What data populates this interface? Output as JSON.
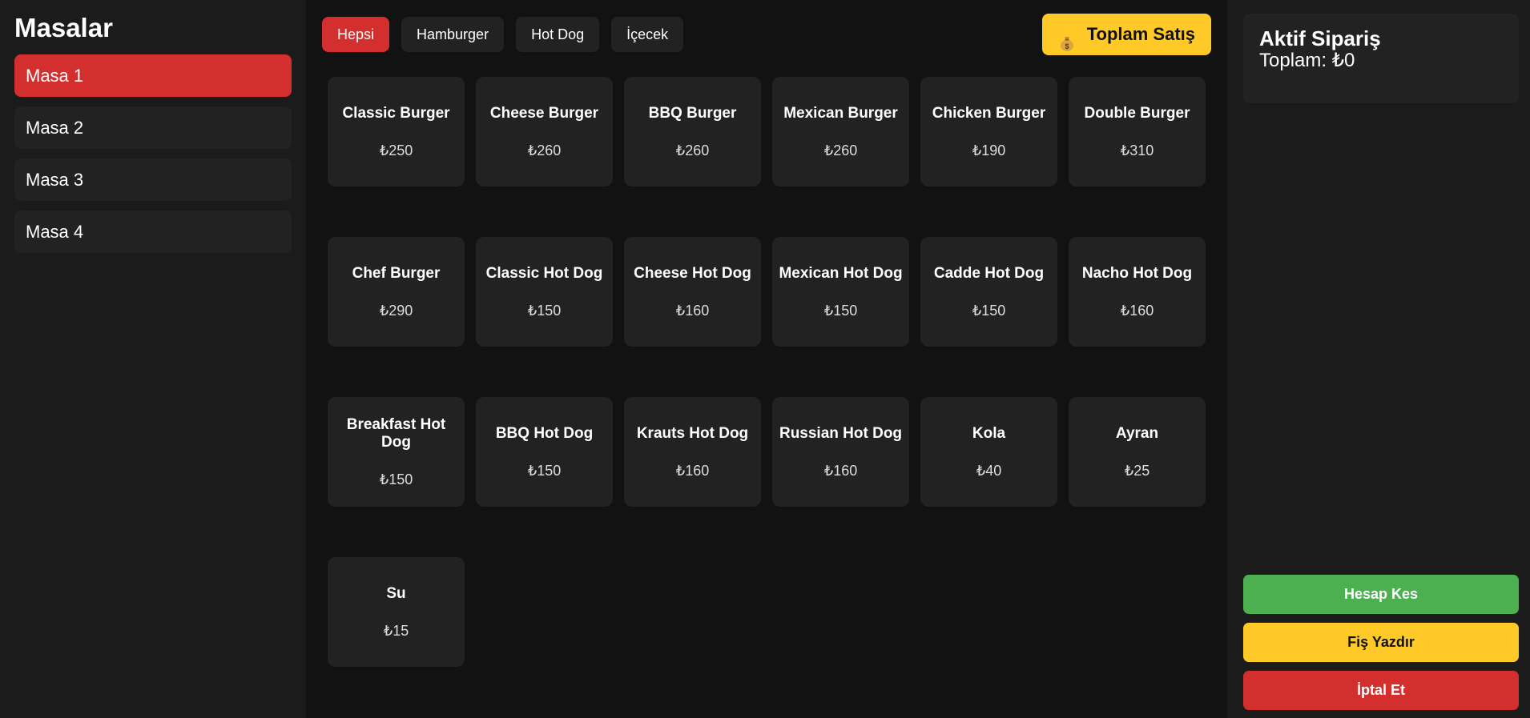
{
  "sidebar": {
    "title": "Masalar",
    "tables": [
      {
        "label": "Masa 1",
        "active": true
      },
      {
        "label": "Masa 2",
        "active": false
      },
      {
        "label": "Masa 3",
        "active": false
      },
      {
        "label": "Masa 4",
        "active": false
      }
    ]
  },
  "filters": [
    {
      "label": "Hepsi",
      "active": true
    },
    {
      "label": "Hamburger",
      "active": false
    },
    {
      "label": "Hot Dog",
      "active": false
    },
    {
      "label": "İçecek",
      "active": false
    }
  ],
  "total_sales_button": {
    "icon": "money-bag-icon",
    "label": "Toplam Satış"
  },
  "products": [
    {
      "name": "Classic Burger",
      "price": "₺250"
    },
    {
      "name": "Cheese Burger",
      "price": "₺260"
    },
    {
      "name": "BBQ Burger",
      "price": "₺260"
    },
    {
      "name": "Mexican Burger",
      "price": "₺260"
    },
    {
      "name": "Chicken Burger",
      "price": "₺190"
    },
    {
      "name": "Double Burger",
      "price": "₺310"
    },
    {
      "name": "Chef Burger",
      "price": "₺290"
    },
    {
      "name": "Classic Hot Dog",
      "price": "₺150"
    },
    {
      "name": "Cheese Hot Dog",
      "price": "₺160"
    },
    {
      "name": "Mexican Hot Dog",
      "price": "₺150"
    },
    {
      "name": "Cadde Hot Dog",
      "price": "₺150"
    },
    {
      "name": "Nacho Hot Dog",
      "price": "₺160"
    },
    {
      "name": "Breakfast Hot Dog",
      "price": "₺150"
    },
    {
      "name": "BBQ Hot Dog",
      "price": "₺150"
    },
    {
      "name": "Krauts Hot Dog",
      "price": "₺160"
    },
    {
      "name": "Russian Hot Dog",
      "price": "₺160"
    },
    {
      "name": "Kola",
      "price": "₺40"
    },
    {
      "name": "Ayran",
      "price": "₺25"
    },
    {
      "name": "Su",
      "price": "₺15"
    }
  ],
  "order": {
    "title": "Aktif Sipariş",
    "total": "Toplam: ₺0"
  },
  "actions": {
    "checkout": "Hesap Kes",
    "print_receipt": "Fiş Yazdır",
    "cancel": "İptal Et"
  },
  "colors": {
    "accent_red": "#d32f2f",
    "accent_yellow": "#ffca28",
    "accent_green": "#4caf50",
    "background": "#121212",
    "panel": "#1b1b1b",
    "card": "#222222"
  }
}
